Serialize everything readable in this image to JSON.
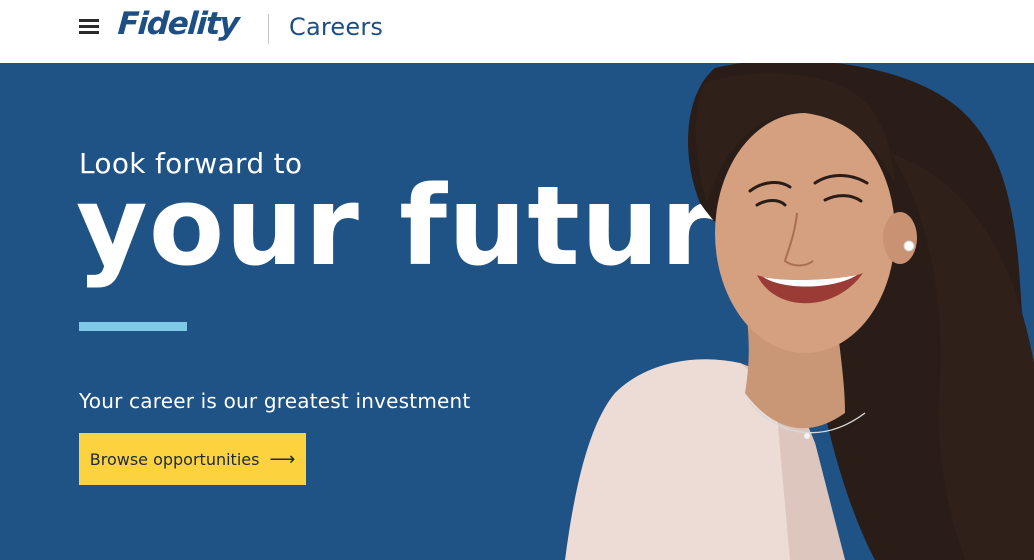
{
  "header": {
    "logo_text": "Fidelity",
    "section_title": "Careers",
    "menu_icon": "hamburger-menu-icon"
  },
  "hero": {
    "kicker": "Look forward to",
    "headline": "your future",
    "subhead": "Your career is our greatest investment",
    "cta_label": "Browse opportunities",
    "cta_icon": "arrow-right-icon",
    "cta_arrow": "⟶",
    "image": "smiling-woman-portrait"
  },
  "colors": {
    "brand_blue": "#1d4f84",
    "hero_bg": "#1f5285",
    "accent_bar": "#7fc8e8",
    "cta_yellow": "#fcd33f",
    "header_bg": "#ffffff"
  }
}
